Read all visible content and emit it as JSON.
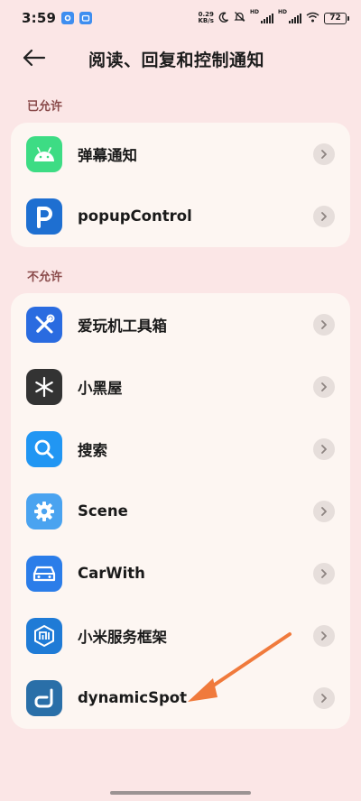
{
  "status_bar": {
    "time": "3:59",
    "net_speed_value": "0.29",
    "net_speed_unit": "KB/s",
    "hd1": "HD",
    "hd2": "HD",
    "battery": "72"
  },
  "header": {
    "title": "阅读、回复和控制通知"
  },
  "allowed": {
    "label": "已允许",
    "apps": [
      {
        "name": "弹幕通知",
        "icon": "android-icon",
        "color": "#3ddc84"
      },
      {
        "name": "popupControl",
        "icon": "p-letter-icon",
        "color": "#1e6fd1"
      }
    ]
  },
  "not_allowed": {
    "label": "不允许",
    "apps": [
      {
        "name": "爱玩机工具箱",
        "icon": "wrench-screwdriver-icon",
        "color": "#2a6be0"
      },
      {
        "name": "小黑屋",
        "icon": "snowflake-icon",
        "color": "#333333"
      },
      {
        "name": "搜索",
        "icon": "magnifier-icon",
        "color": "#2196f3"
      },
      {
        "name": "Scene",
        "icon": "gear-icon",
        "color": "#4aa3f0"
      },
      {
        "name": "CarWith",
        "icon": "car-icon",
        "color": "#2b7de9"
      },
      {
        "name": "小米服务框架",
        "icon": "mi-hexagon-icon",
        "color": "#1f7bd6"
      },
      {
        "name": "dynamicSpot",
        "icon": "d-letter-icon",
        "color": "#2a6fa8"
      }
    ]
  },
  "annotation": {
    "arrow_color": "#f07a3c"
  }
}
